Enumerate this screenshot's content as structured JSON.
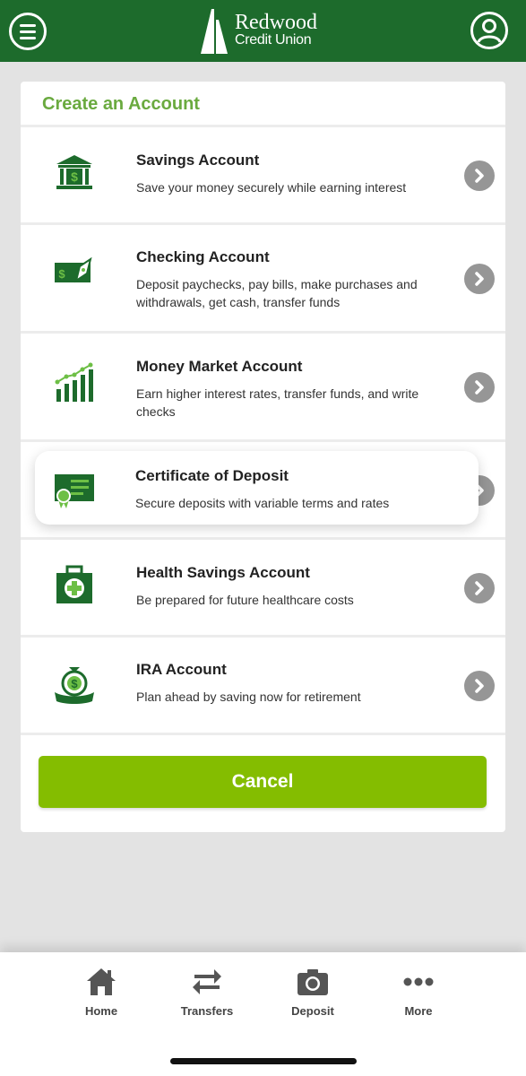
{
  "header": {
    "brand_name": "Redwood",
    "brand_sub": "Credit Union",
    "menu_icon": "hamburger-menu-icon",
    "profile_icon": "user-profile-icon",
    "brand_color": "#1d6b2c"
  },
  "card": {
    "title": "Create an Account",
    "accounts": [
      {
        "title": "Savings Account",
        "description": "Save your money securely while earning interest",
        "icon": "bank-dollar-icon"
      },
      {
        "title": "Checking Account",
        "description": "Deposit paychecks, pay bills, make purchases and withdrawals, get cash, transfer funds",
        "icon": "check-pen-icon"
      },
      {
        "title": "Money Market Account",
        "description": "Earn higher interest rates, transfer funds, and write checks",
        "icon": "growth-chart-icon"
      },
      {
        "title": "Certificate of Deposit",
        "description": "Secure deposits with variable terms and rates",
        "icon": "certificate-icon"
      },
      {
        "title": "Health Savings Account",
        "description": "Be prepared for future healthcare costs",
        "icon": "medical-kit-icon"
      },
      {
        "title": "IRA Account",
        "description": "Plan ahead by saving now for retirement",
        "icon": "money-bag-banner-icon"
      }
    ],
    "cancel_label": "Cancel"
  },
  "colors": {
    "accent_green": "#84bd00",
    "title_green": "#6aaa3f",
    "icon_green": "#1d6b2c",
    "chevron_gray": "#969696"
  },
  "bottom_nav": {
    "items": [
      {
        "label": "Home",
        "icon": "home-icon"
      },
      {
        "label": "Transfers",
        "icon": "transfer-arrows-icon"
      },
      {
        "label": "Deposit",
        "icon": "camera-icon"
      },
      {
        "label": "More",
        "icon": "more-dots-icon"
      }
    ]
  }
}
